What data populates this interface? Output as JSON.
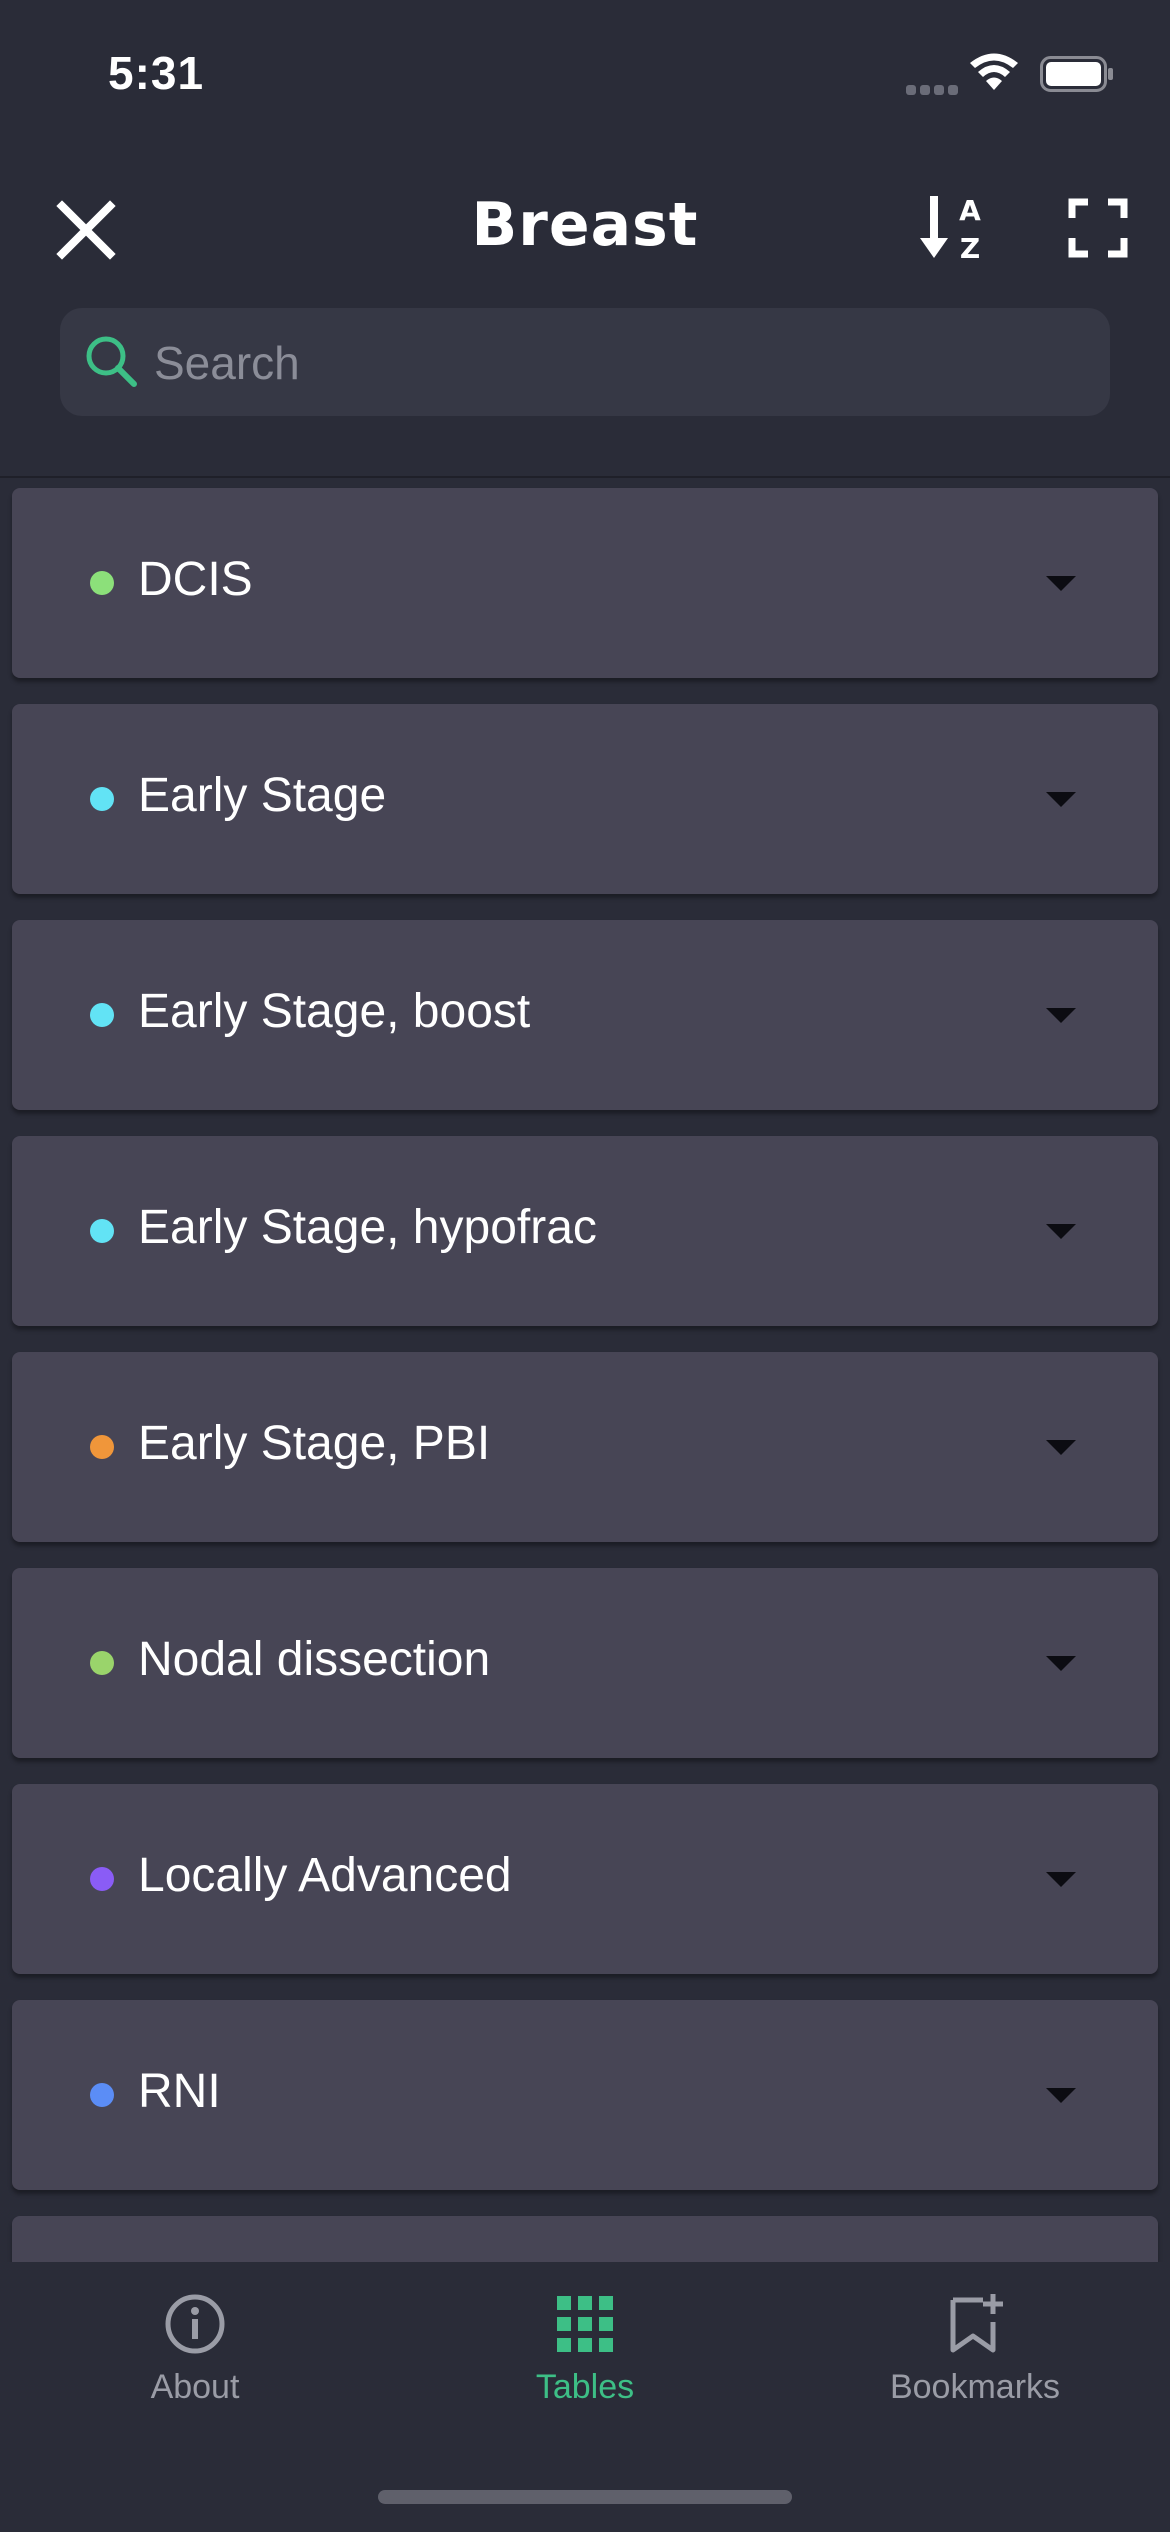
{
  "status_bar": {
    "time": "5:31"
  },
  "header": {
    "title": "Breast",
    "search_placeholder": "Search"
  },
  "list": {
    "items": [
      {
        "label": "DCIS",
        "color": "#8ce07a"
      },
      {
        "label": "Early Stage",
        "color": "#62e3f5"
      },
      {
        "label": "Early Stage, boost",
        "color": "#62e3f5"
      },
      {
        "label": "Early Stage, hypofrac",
        "color": "#62e3f5"
      },
      {
        "label": "Early Stage, PBI",
        "color": "#f0963a"
      },
      {
        "label": "Nodal dissection",
        "color": "#9ad46b"
      },
      {
        "label": "Locally Advanced",
        "color": "#8a5cf6"
      },
      {
        "label": "RNI",
        "color": "#5b8df6"
      }
    ]
  },
  "tab_bar": {
    "tabs": [
      {
        "label": "About",
        "icon": "info-icon",
        "active": false
      },
      {
        "label": "Tables",
        "icon": "grid-icon",
        "active": true
      },
      {
        "label": "Bookmarks",
        "icon": "bookmark-add-icon",
        "active": false
      }
    ],
    "active_color": "#3dbf86",
    "inactive_color": "#9a9ca6"
  }
}
